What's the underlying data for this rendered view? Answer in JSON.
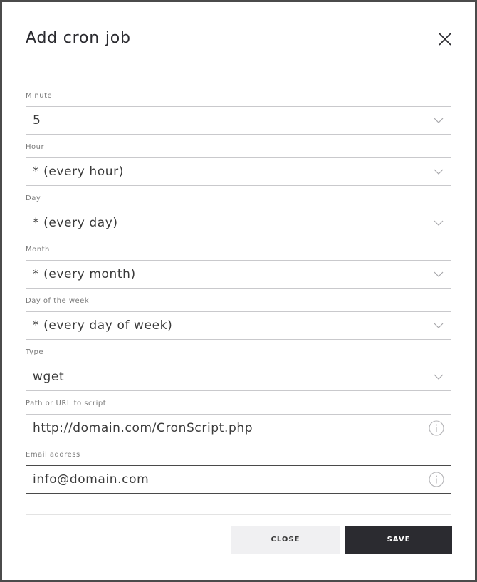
{
  "modal": {
    "title": "Add cron job"
  },
  "fields": [
    {
      "label": "Minute",
      "value": "5",
      "kind": "select"
    },
    {
      "label": "Hour",
      "value": "* (every hour)",
      "kind": "select"
    },
    {
      "label": "Day",
      "value": "* (every day)",
      "kind": "select"
    },
    {
      "label": "Month",
      "value": "* (every month)",
      "kind": "select"
    },
    {
      "label": "Day of the week",
      "value": "* (every day of week)",
      "kind": "select"
    },
    {
      "label": "Type",
      "value": "wget",
      "kind": "select"
    },
    {
      "label": "Path or URL to script",
      "value": "http://domain.com/CronScript.php",
      "kind": "text"
    },
    {
      "label": "Email address",
      "value": "info@domain.com",
      "kind": "text"
    }
  ],
  "buttons": {
    "close_label": "CLOSE",
    "save_label": "SAVE"
  },
  "icons": {
    "close": "close-x-icon",
    "chevron": "chevron-down-icon",
    "info": "info-icon"
  },
  "colors": {
    "save_bg": "#2b2b30",
    "close_bg": "#f0f0f2",
    "border": "#c9c9cc"
  }
}
